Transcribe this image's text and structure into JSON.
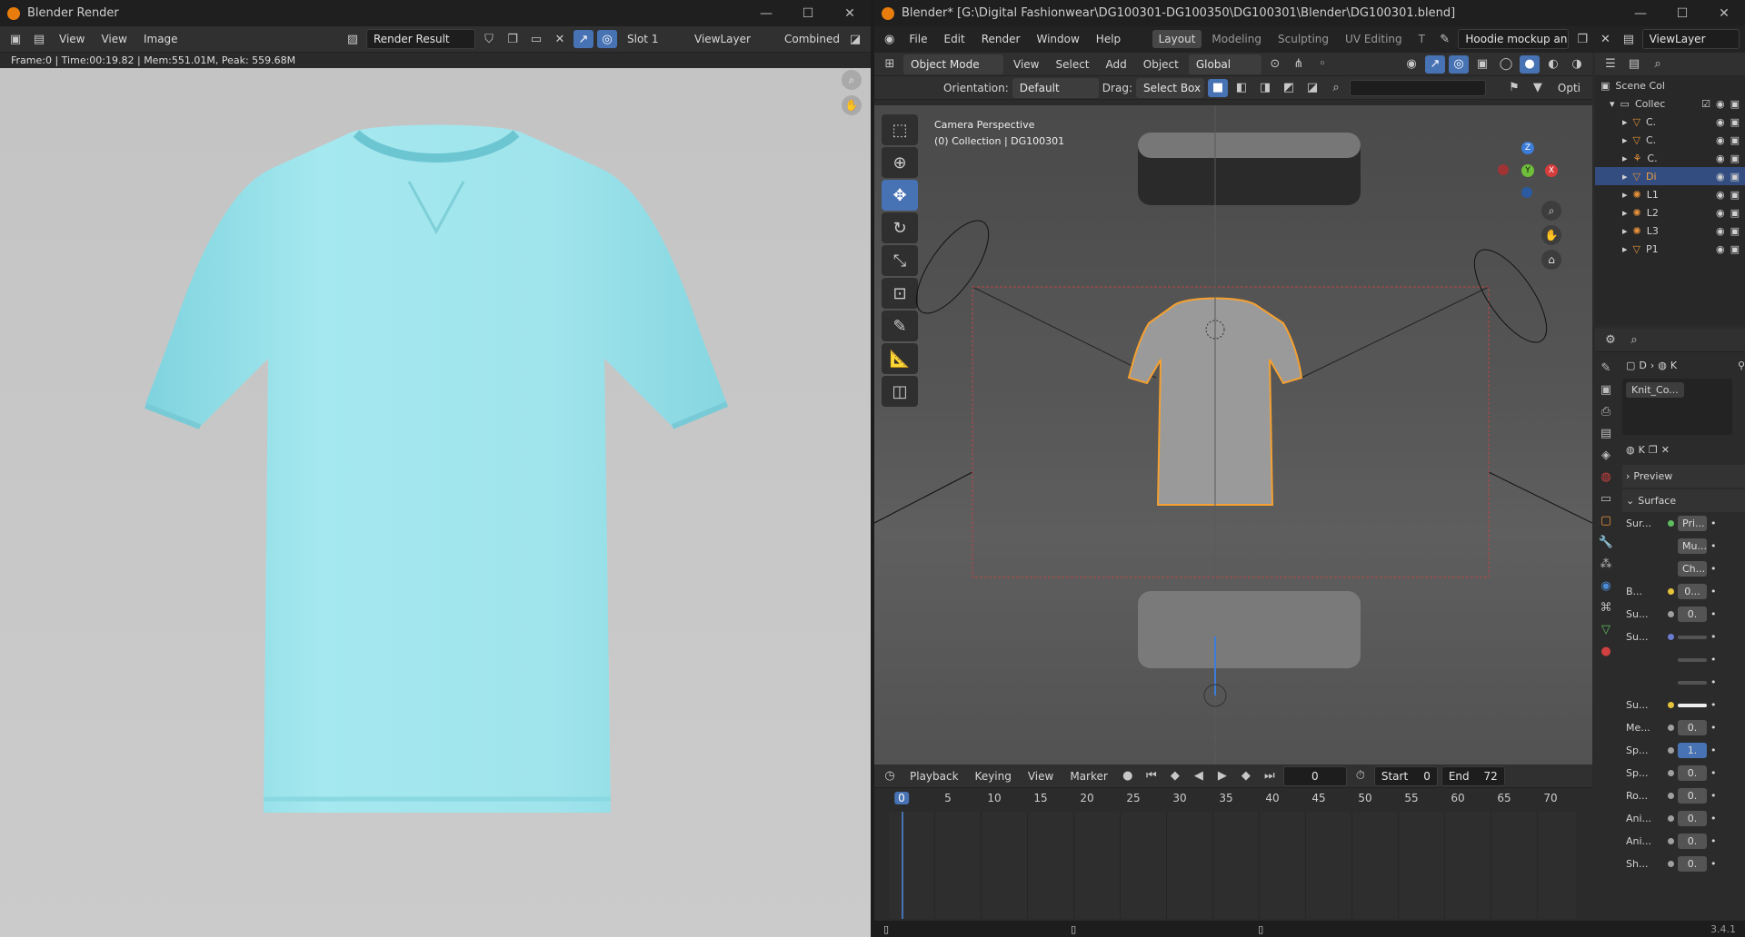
{
  "left_window": {
    "title": "Blender Render",
    "controls": [
      "—",
      "☐",
      "✕"
    ],
    "header": {
      "view_menu": "View",
      "view2": "View",
      "image": "Image",
      "image_name": "Render Result",
      "slot": "Slot 1",
      "view_layer": "ViewLayer",
      "pass": "Combined"
    },
    "info": "Frame:0 | Time:00:19.82 | Mem:551.01M, Peak: 559.68M",
    "shirt_color": "#9fe5eb"
  },
  "right_window": {
    "title": "Blender* [G:\\Digital Fashionwear\\DG100301-DG100350\\DG100301\\Blender\\DG100301.blend]",
    "controls": [
      "—",
      "☐",
      "✕"
    ],
    "menus": [
      "File",
      "Edit",
      "Render",
      "Window",
      "Help"
    ],
    "workspaces": [
      "Layout",
      "Modeling",
      "Sculpting",
      "UV Editing",
      "T"
    ],
    "scene_name": "Hoodie mockup ani...",
    "view_layer": "ViewLayer",
    "viewport_header": {
      "mode": "Object Mode",
      "menus": [
        "View",
        "Select",
        "Add",
        "Object"
      ],
      "transform": "Global"
    },
    "tool_settings": {
      "orientation_label": "Orientation:",
      "orientation": "Default",
      "drag_label": "Drag:",
      "drag": "Select Box",
      "options": "Opti"
    },
    "viewport_overlay": {
      "line1": "Camera Perspective",
      "line2": "(0) Collection | DG100301"
    },
    "gizmo": {
      "z": "Z",
      "y": "Y",
      "x": "X"
    },
    "timeline": {
      "menus": [
        "Playback",
        "Keying",
        "View",
        "Marker"
      ],
      "current_frame": "0",
      "start_label": "Start",
      "start": "0",
      "end_label": "End",
      "end": "72",
      "ticks": [
        "0",
        "5",
        "10",
        "15",
        "20",
        "25",
        "30",
        "35",
        "40",
        "45",
        "50",
        "55",
        "60",
        "65",
        "70"
      ]
    },
    "outliner": {
      "scene_collection": "Scene Col",
      "collection": "Collec",
      "items": [
        {
          "label": "C.",
          "type": "mesh"
        },
        {
          "label": "C.",
          "type": "mesh"
        },
        {
          "label": "C.",
          "type": "camera"
        },
        {
          "label": "Di",
          "type": "mesh",
          "selected": true
        },
        {
          "label": "L1",
          "type": "light"
        },
        {
          "label": "L2",
          "type": "light"
        },
        {
          "label": "L3",
          "type": "light"
        },
        {
          "label": "P1",
          "type": "mesh"
        }
      ]
    },
    "properties": {
      "breadcrumb": [
        "D",
        "K"
      ],
      "material_slot": "Knit_Co...",
      "material_short": "K",
      "preview": "Preview",
      "surface": "Surface",
      "rows": [
        {
          "label": "Sur...",
          "value": "Pri...",
          "dot": "#5fbd5f"
        },
        {
          "label": "",
          "value": "Mu...",
          "dot": ""
        },
        {
          "label": "",
          "value": "Ch...",
          "dot": ""
        },
        {
          "label": "B...",
          "value": "0...",
          "dot": "#e5c33a"
        },
        {
          "label": "Su...",
          "value": "0.",
          "dot": "#a0a0a0"
        },
        {
          "label": "Su...",
          "value": "",
          "dot": "#6b7bd0"
        },
        {
          "label": "",
          "value": "",
          "dot": ""
        },
        {
          "label": "",
          "value": "",
          "dot": ""
        },
        {
          "label": "Su...",
          "value": "",
          "dot": "#e5c33a"
        },
        {
          "label": "Me...",
          "value": "0.",
          "dot": "#a0a0a0"
        },
        {
          "label": "Sp...",
          "value": "1.",
          "dot": "#a0a0a0"
        },
        {
          "label": "Sp...",
          "value": "0.",
          "dot": "#a0a0a0"
        },
        {
          "label": "Ro...",
          "value": "0.",
          "dot": "#a0a0a0"
        },
        {
          "label": "Ani...",
          "value": "0.",
          "dot": "#a0a0a0"
        },
        {
          "label": "Ani...",
          "value": "0.",
          "dot": "#a0a0a0"
        },
        {
          "label": "Sh...",
          "value": "0.",
          "dot": "#a0a0a0"
        }
      ]
    },
    "version": "3.4.1"
  }
}
